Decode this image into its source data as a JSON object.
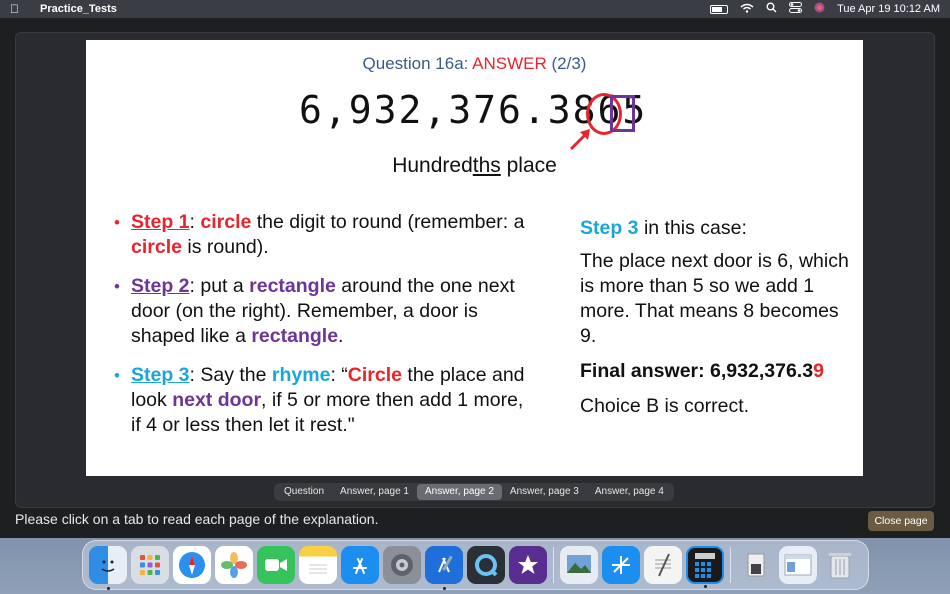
{
  "menubar": {
    "app_name": "Practice_Tests",
    "datetime": "Tue Apr 19  10:12 AM",
    "icons": [
      "apple-icon",
      "battery-icon",
      "wifi-icon",
      "search-icon",
      "control-center-icon",
      "siri-icon"
    ]
  },
  "slide": {
    "title_prefix": "Question 16a: ",
    "title_answer": "ANSWER",
    "title_suffix": " (2/3)",
    "number": "6,932,376.3865",
    "place_prefix": "Hundred",
    "place_underlined": "ths",
    "place_suffix": " place",
    "steps": [
      {
        "label": "Step 1",
        "parts": [
          ": ",
          "circle",
          " the digit to round (remember: a ",
          "circle",
          " is round)."
        ]
      },
      {
        "label": "Step 2",
        "parts": [
          ": put a ",
          "rectangle",
          " around the one next door (on the right). Remember, a door is shaped like a ",
          "rectangle",
          "."
        ]
      },
      {
        "label": "Step 3",
        "parts": [
          ": Say the ",
          "rhyme",
          ": “",
          "Circle",
          " the place and look ",
          "next door",
          ", if 5 or more then add 1 more, if 4 or less then let it rest.\""
        ]
      }
    ],
    "right": {
      "title_label": "Step 3",
      "title_rest": " in this case:",
      "body": "The place next door is 6, which is more than 5 so we add 1 more. That means 8 becomes 9.",
      "final_prefix": "Final answer: 6,932,376.3",
      "final_digit": "9",
      "choice": "Choice B is correct."
    }
  },
  "tabs": [
    "Question",
    "Answer, page 1",
    "Answer, page 2",
    "Answer, page 3",
    "Answer, page 4"
  ],
  "active_tab": "Answer, page 2",
  "footer_text": "Please click on a tab to read each page of the explanation.",
  "close_button": "Close page",
  "colors": {
    "red": "#e8242c",
    "purple": "#6d3596",
    "blue": "#1aa6d8",
    "title_blue": "#3b5a8a",
    "close_button": "#6b5b42"
  },
  "dock": {
    "apps": [
      "finder-icon",
      "launchpad-icon",
      "safari-icon",
      "photos-icon",
      "facetime-icon",
      "notes-icon",
      "app-store-icon",
      "system-preferences-icon",
      "xcode-icon",
      "quicktime-icon",
      "imovie-icon",
      "preview-icon",
      "testflight-icon",
      "textedit-icon",
      "calculator-icon",
      "scanner-icon",
      "finder-window-icon",
      "trash-icon"
    ]
  }
}
